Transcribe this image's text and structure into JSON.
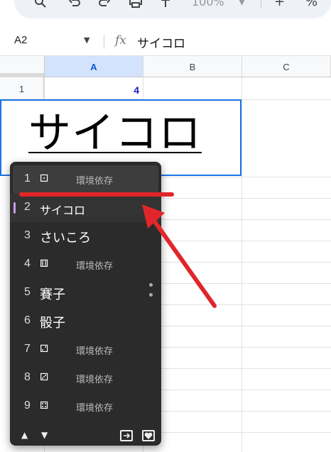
{
  "toolbar": {
    "icons": [
      "search-icon",
      "undo-icon",
      "redo-icon",
      "print-icon",
      "paint-format-icon"
    ],
    "zoom": "100%",
    "zoom_out": "-",
    "zoom_in": "+",
    "percent": "%"
  },
  "formula_bar": {
    "cell_ref": "A2",
    "fx": "fx",
    "value": "サイコロ"
  },
  "grid": {
    "columns": [
      "A",
      "B",
      "C"
    ],
    "rows": [
      "1"
    ],
    "a1_value": "4",
    "editing_text": "サイコロ"
  },
  "ime": {
    "candidates": [
      {
        "num": "1",
        "word": "⚀",
        "note": "環境依存"
      },
      {
        "num": "2",
        "word": "サイコロ",
        "note": ""
      },
      {
        "num": "3",
        "word": "さいころ",
        "note": ""
      },
      {
        "num": "4",
        "word": "⚅",
        "note": "環境依存"
      },
      {
        "num": "5",
        "word": "賽子",
        "note": ""
      },
      {
        "num": "6",
        "word": "骰子",
        "note": ""
      },
      {
        "num": "7",
        "word": "⚁",
        "note": "環境依存"
      },
      {
        "num": "8",
        "word": "⚂",
        "note": "環境依存"
      },
      {
        "num": "9",
        "word": "⚃",
        "note": "環境依存"
      }
    ],
    "footer": {
      "up": "▲",
      "down": "▼"
    }
  },
  "colors": {
    "accent": "#1a73e8",
    "annotation": "#e0262a",
    "ime_bg": "#2b2b2b"
  }
}
